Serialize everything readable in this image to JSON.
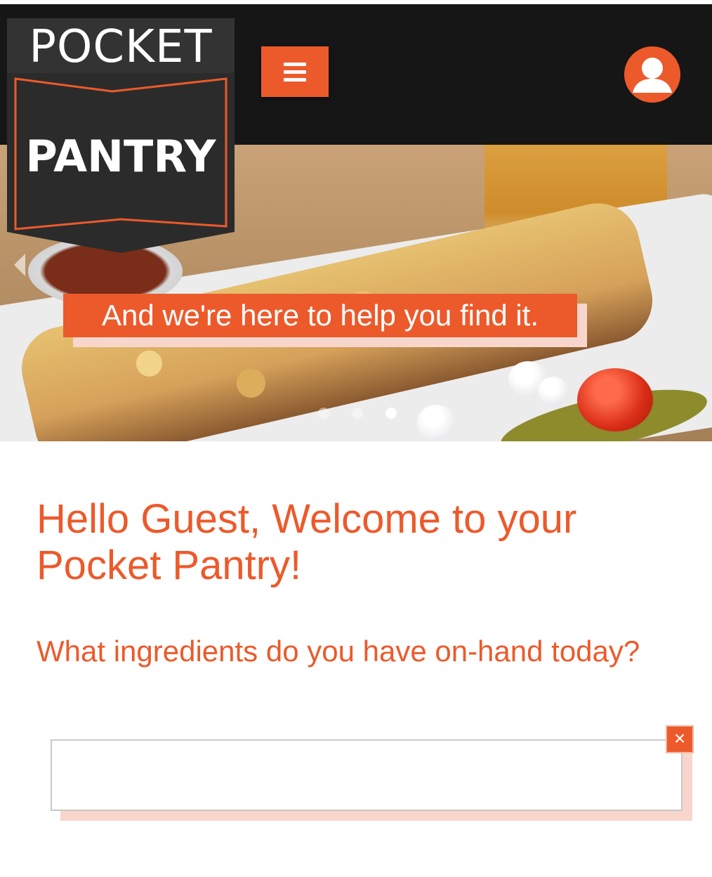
{
  "brand": {
    "logo_top": "POCKET",
    "logo_bottom": "PANTRY",
    "accent_color": "#ec5a2b",
    "header_color": "#161616"
  },
  "header": {
    "menu_icon": "hamburger-icon",
    "profile_icon": "user-avatar-icon"
  },
  "hero": {
    "caption": "And we're here to help you find it.",
    "slides_total": 3,
    "active_slide": 3
  },
  "main": {
    "welcome": "Hello Guest, Welcome to your Pocket Pantry!",
    "question": "What ingredients do you have on-hand today?",
    "ingredient_input_value": "",
    "clear_symbol": "×"
  }
}
